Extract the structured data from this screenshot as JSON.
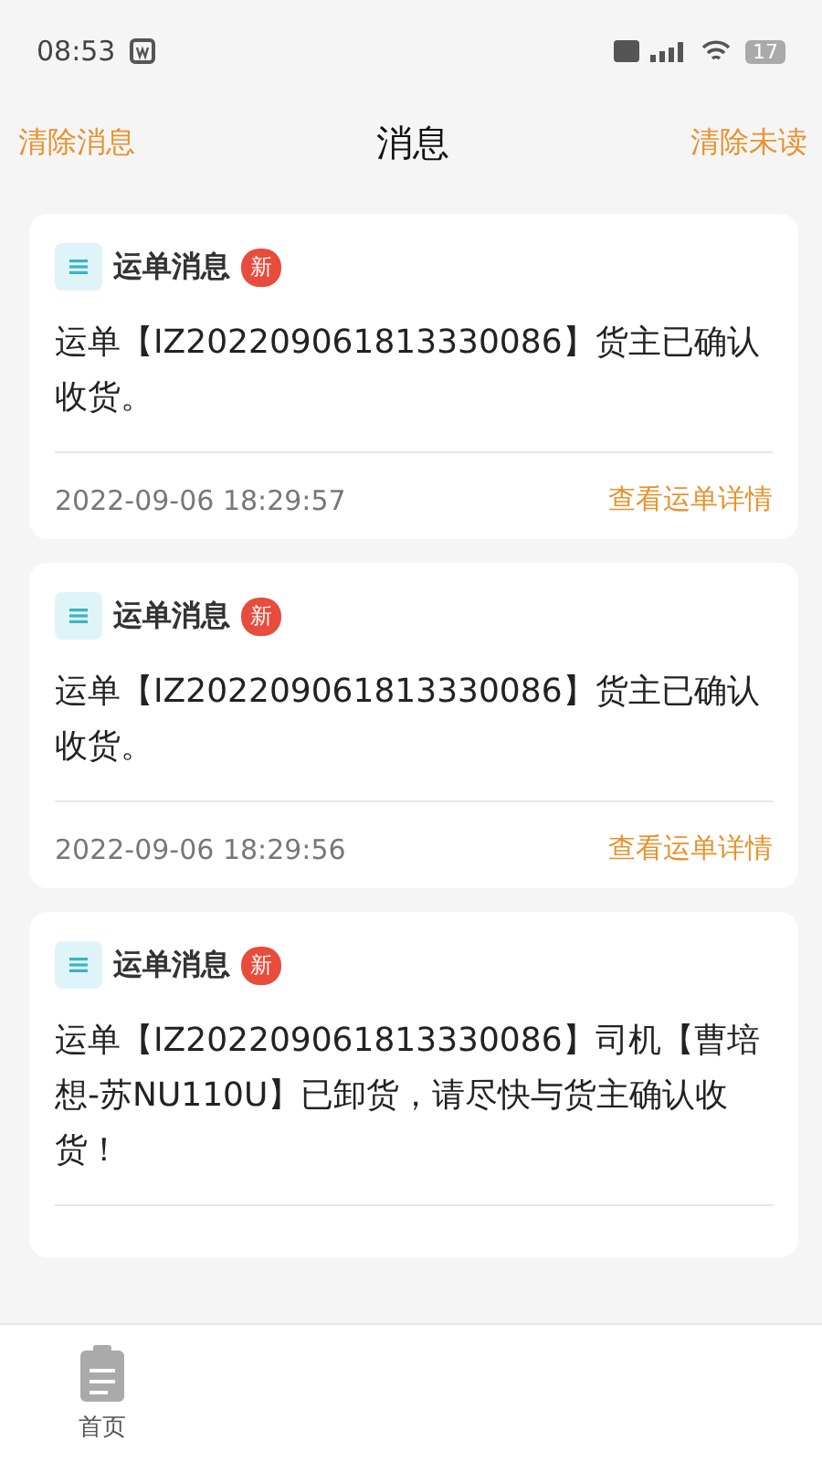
{
  "status_bar": {
    "time": "08:53",
    "battery": "17"
  },
  "header": {
    "left_action": "清除消息",
    "title": "消息",
    "right_action": "清除未读"
  },
  "messages": [
    {
      "category": "运单消息",
      "badge": "新",
      "unread": true,
      "text": "运单【IZ202209061813330086】货主已确认收货。",
      "time": "2022-09-06 18:29:57",
      "link": "查看运单详情"
    },
    {
      "category": "运单消息",
      "badge": "新",
      "unread": true,
      "text": "运单【IZ202209061813330086】货主已确认收货。",
      "time": "2022-09-06 18:29:56",
      "link": "查看运单详情"
    },
    {
      "category": "运单消息",
      "badge": "新",
      "unread": true,
      "text": "运单【IZ202209061813330086】司机【曹培想-苏NU110U】已卸货，请尽快与货主确认收货！"
    }
  ],
  "tab_bar": {
    "tabs": [
      {
        "label": "首页",
        "selected": false
      }
    ]
  }
}
